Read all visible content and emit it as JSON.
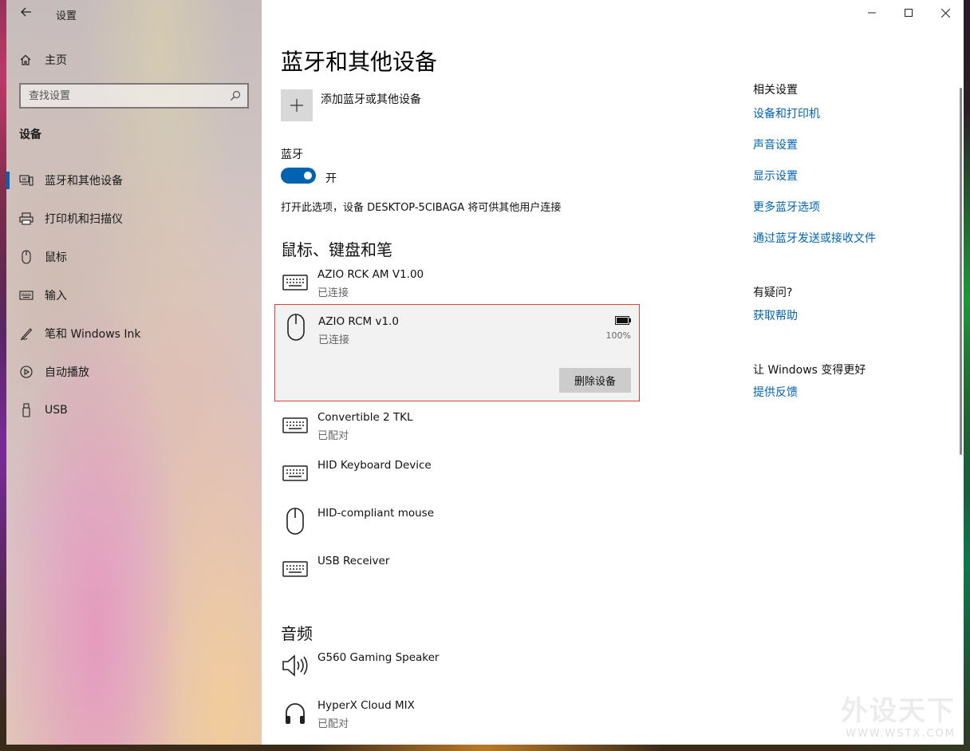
{
  "window": {
    "title": "设置"
  },
  "sidebar": {
    "home_label": "主页",
    "search_placeholder": "查找设置",
    "section_title": "设备",
    "items": [
      {
        "label": "蓝牙和其他设备",
        "icon": "bluetooth-devices-icon",
        "active": true
      },
      {
        "label": "打印机和扫描仪",
        "icon": "printer-icon",
        "active": false
      },
      {
        "label": "鼠标",
        "icon": "mouse-icon",
        "active": false
      },
      {
        "label": "输入",
        "icon": "keyboard-icon",
        "active": false
      },
      {
        "label": "笔和 Windows Ink",
        "icon": "pen-icon",
        "active": false
      },
      {
        "label": "自动播放",
        "icon": "autoplay-icon",
        "active": false
      },
      {
        "label": "USB",
        "icon": "usb-icon",
        "active": false
      }
    ]
  },
  "main": {
    "title": "蓝牙和其他设备",
    "add_device_label": "添加蓝牙或其他设备",
    "bluetooth_label": "蓝牙",
    "bluetooth_toggle_state": "开",
    "bluetooth_description": "打开此选项，设备 DESKTOP-5CIBAGA 将可供其他用户连接",
    "input_section_title": "鼠标、键盘和笔",
    "input_devices": [
      {
        "name": "AZIO RCK AM V1.00",
        "status": "已连接",
        "icon": "keyboard-icon"
      },
      {
        "name": "AZIO RCM v1.0",
        "status": "已连接",
        "icon": "mouse-icon",
        "battery": "100%",
        "remove_label": "删除设备"
      },
      {
        "name": "Convertible 2 TKL",
        "status": "已配对",
        "icon": "keyboard-icon"
      },
      {
        "name": "HID Keyboard Device",
        "status": "",
        "icon": "keyboard-icon"
      },
      {
        "name": "HID-compliant mouse",
        "status": "",
        "icon": "mouse-icon"
      },
      {
        "name": "USB Receiver",
        "status": "",
        "icon": "keyboard-icon"
      }
    ],
    "audio_section_title": "音频",
    "audio_devices": [
      {
        "name": "G560 Gaming Speaker",
        "status": "",
        "icon": "speaker-icon"
      },
      {
        "name": "HyperX Cloud MIX",
        "status": "已配对",
        "icon": "headphones-icon"
      }
    ]
  },
  "related": {
    "title": "相关设置",
    "links": [
      "设备和打印机",
      "声音设置",
      "显示设置",
      "更多蓝牙选项",
      "通过蓝牙发送或接收文件"
    ],
    "help_title": "有疑问?",
    "help_link": "获取帮助",
    "feedback_title": "让 Windows 变得更好",
    "feedback_link": "提供反馈"
  },
  "watermark": {
    "main": "外设天下",
    "url": "WWW.WSTX.COM"
  },
  "colors": {
    "accent": "#0063b1",
    "selected_border": "#e0403a"
  }
}
